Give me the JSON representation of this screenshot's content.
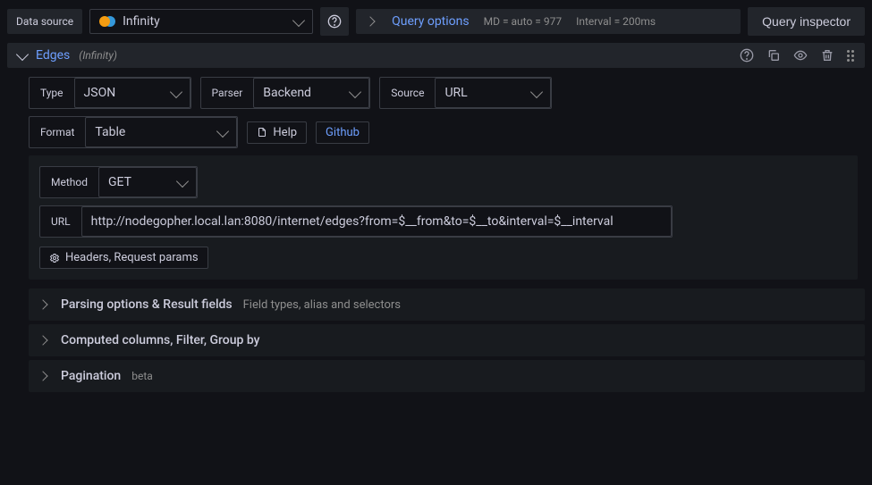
{
  "toolbar": {
    "data_source_label": "Data source",
    "data_source_name": "Infinity",
    "query_options_label": "Query options",
    "md_text": "MD = auto = 977",
    "interval_text": "Interval = 200ms",
    "query_inspector_label": "Query inspector"
  },
  "query": {
    "title": "Edges",
    "hint": "(Infinity)",
    "type": {
      "label": "Type",
      "value": "JSON"
    },
    "parser": {
      "label": "Parser",
      "value": "Backend"
    },
    "source": {
      "label": "Source",
      "value": "URL"
    },
    "format": {
      "label": "Format",
      "value": "Table"
    },
    "help_label": "Help",
    "github_label": "Github",
    "method": {
      "label": "Method",
      "value": "GET"
    },
    "url": {
      "label": "URL",
      "value": "http://nodegopher.local.lan:8080/internet/edges?from=$__from&to=$__to&interval=$__interval"
    },
    "headers_label": "Headers, Request params"
  },
  "sections": {
    "parsing": {
      "title": "Parsing options & Result fields",
      "hint": "Field types, alias and selectors"
    },
    "computed": {
      "title": "Computed columns, Filter, Group by"
    },
    "pagination": {
      "title": "Pagination",
      "badge": "beta"
    }
  }
}
